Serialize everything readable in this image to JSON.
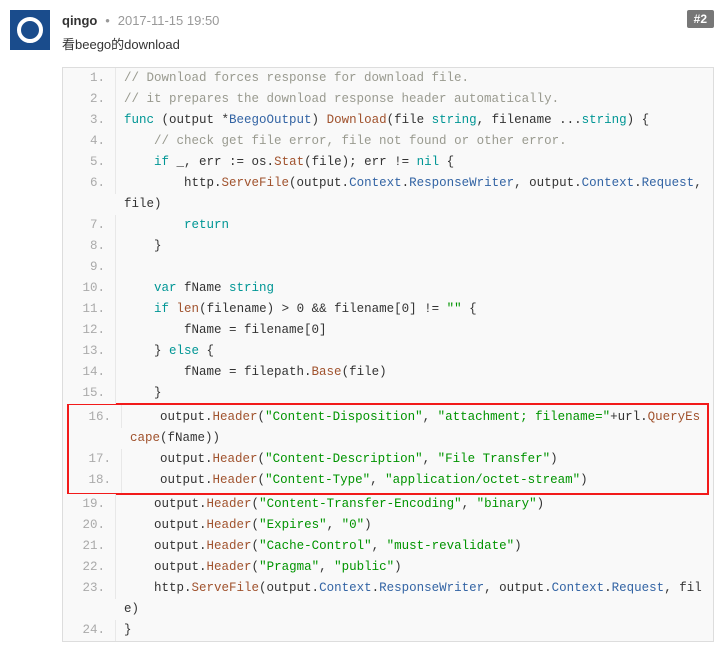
{
  "post": {
    "username": "qingo",
    "timestamp": "2017-11-15 19:50",
    "number": "#2",
    "body": "看beego的download"
  },
  "code": {
    "lines": [
      {
        "n": "1.",
        "tokens": [
          [
            "c-comment",
            "// Download forces response for download file."
          ]
        ],
        "hl": false
      },
      {
        "n": "2.",
        "tokens": [
          [
            "c-comment",
            "// it prepares the download response header automatically."
          ]
        ],
        "hl": false
      },
      {
        "n": "3.",
        "tokens": [
          [
            "c-keyword",
            "func"
          ],
          [
            "c-sym",
            " (output *"
          ],
          [
            "c-type",
            "BeegoOutput"
          ],
          [
            "c-sym",
            ") "
          ],
          [
            "c-func",
            "Download"
          ],
          [
            "c-sym",
            "(file "
          ],
          [
            "c-keyword",
            "string"
          ],
          [
            "c-sym",
            ", filename ..."
          ],
          [
            "c-keyword",
            "string"
          ],
          [
            "c-sym",
            ") {"
          ]
        ],
        "hl": false
      },
      {
        "n": "4.",
        "tokens": [
          [
            "c-sym",
            "    "
          ],
          [
            "c-comment",
            "// check get file error, file not found or other error."
          ]
        ],
        "hl": false
      },
      {
        "n": "5.",
        "tokens": [
          [
            "c-sym",
            "    "
          ],
          [
            "c-keyword",
            "if"
          ],
          [
            "c-sym",
            " _, err := os."
          ],
          [
            "c-func",
            "Stat"
          ],
          [
            "c-sym",
            "(file); err != "
          ],
          [
            "c-keyword",
            "nil"
          ],
          [
            "c-sym",
            " {"
          ]
        ],
        "hl": false
      },
      {
        "n": "6.",
        "tokens": [
          [
            "c-sym",
            "        http."
          ],
          [
            "c-func",
            "ServeFile"
          ],
          [
            "c-sym",
            "(output."
          ],
          [
            "c-pkg",
            "Context"
          ],
          [
            "c-sym",
            "."
          ],
          [
            "c-pkg",
            "ResponseWriter"
          ],
          [
            "c-sym",
            ", output."
          ],
          [
            "c-pkg",
            "Context"
          ],
          [
            "c-sym",
            "."
          ],
          [
            "c-pkg",
            "Request"
          ],
          [
            "c-sym",
            ", file)"
          ]
        ],
        "hl": false
      },
      {
        "n": "7.",
        "tokens": [
          [
            "c-sym",
            "        "
          ],
          [
            "c-keyword",
            "return"
          ]
        ],
        "hl": false
      },
      {
        "n": "8.",
        "tokens": [
          [
            "c-sym",
            "    }"
          ]
        ],
        "hl": false
      },
      {
        "n": "9.",
        "tokens": [
          [
            "c-sym",
            " "
          ]
        ],
        "hl": false
      },
      {
        "n": "10.",
        "tokens": [
          [
            "c-sym",
            "    "
          ],
          [
            "c-keyword",
            "var"
          ],
          [
            "c-sym",
            " fName "
          ],
          [
            "c-keyword",
            "string"
          ]
        ],
        "hl": false
      },
      {
        "n": "11.",
        "tokens": [
          [
            "c-sym",
            "    "
          ],
          [
            "c-keyword",
            "if"
          ],
          [
            "c-sym",
            " "
          ],
          [
            "c-func",
            "len"
          ],
          [
            "c-sym",
            "(filename) > 0 && filename[0] != "
          ],
          [
            "c-string",
            "\"\""
          ],
          [
            "c-sym",
            " {"
          ]
        ],
        "hl": false
      },
      {
        "n": "12.",
        "tokens": [
          [
            "c-sym",
            "        fName = filename[0]"
          ]
        ],
        "hl": false
      },
      {
        "n": "13.",
        "tokens": [
          [
            "c-sym",
            "    } "
          ],
          [
            "c-keyword",
            "else"
          ],
          [
            "c-sym",
            " {"
          ]
        ],
        "hl": false
      },
      {
        "n": "14.",
        "tokens": [
          [
            "c-sym",
            "        fName = filepath."
          ],
          [
            "c-func",
            "Base"
          ],
          [
            "c-sym",
            "(file)"
          ]
        ],
        "hl": false
      },
      {
        "n": "15.",
        "tokens": [
          [
            "c-sym",
            "    }"
          ]
        ],
        "hl": false
      },
      {
        "n": "16.",
        "tokens": [
          [
            "c-sym",
            "    output."
          ],
          [
            "c-func",
            "Header"
          ],
          [
            "c-sym",
            "("
          ],
          [
            "c-string",
            "\"Content-Disposition\""
          ],
          [
            "c-sym",
            ", "
          ],
          [
            "c-string",
            "\"attachment; filename=\""
          ],
          [
            "c-sym",
            "+url."
          ],
          [
            "c-func",
            "QueryEscape"
          ],
          [
            "c-sym",
            "(fName))"
          ]
        ],
        "hl": true
      },
      {
        "n": "17.",
        "tokens": [
          [
            "c-sym",
            "    output."
          ],
          [
            "c-func",
            "Header"
          ],
          [
            "c-sym",
            "("
          ],
          [
            "c-string",
            "\"Content-Description\""
          ],
          [
            "c-sym",
            ", "
          ],
          [
            "c-string",
            "\"File Transfer\""
          ],
          [
            "c-sym",
            ")"
          ]
        ],
        "hl": true
      },
      {
        "n": "18.",
        "tokens": [
          [
            "c-sym",
            "    output."
          ],
          [
            "c-func",
            "Header"
          ],
          [
            "c-sym",
            "("
          ],
          [
            "c-string",
            "\"Content-Type\""
          ],
          [
            "c-sym",
            ", "
          ],
          [
            "c-string",
            "\"application/octet-stream\""
          ],
          [
            "c-sym",
            ")"
          ]
        ],
        "hl": true
      },
      {
        "n": "19.",
        "tokens": [
          [
            "c-sym",
            "    output."
          ],
          [
            "c-func",
            "Header"
          ],
          [
            "c-sym",
            "("
          ],
          [
            "c-string",
            "\"Content-Transfer-Encoding\""
          ],
          [
            "c-sym",
            ", "
          ],
          [
            "c-string",
            "\"binary\""
          ],
          [
            "c-sym",
            ")"
          ]
        ],
        "hl": false
      },
      {
        "n": "20.",
        "tokens": [
          [
            "c-sym",
            "    output."
          ],
          [
            "c-func",
            "Header"
          ],
          [
            "c-sym",
            "("
          ],
          [
            "c-string",
            "\"Expires\""
          ],
          [
            "c-sym",
            ", "
          ],
          [
            "c-string",
            "\"0\""
          ],
          [
            "c-sym",
            ")"
          ]
        ],
        "hl": false
      },
      {
        "n": "21.",
        "tokens": [
          [
            "c-sym",
            "    output."
          ],
          [
            "c-func",
            "Header"
          ],
          [
            "c-sym",
            "("
          ],
          [
            "c-string",
            "\"Cache-Control\""
          ],
          [
            "c-sym",
            ", "
          ],
          [
            "c-string",
            "\"must-revalidate\""
          ],
          [
            "c-sym",
            ")"
          ]
        ],
        "hl": false
      },
      {
        "n": "22.",
        "tokens": [
          [
            "c-sym",
            "    output."
          ],
          [
            "c-func",
            "Header"
          ],
          [
            "c-sym",
            "("
          ],
          [
            "c-string",
            "\"Pragma\""
          ],
          [
            "c-sym",
            ", "
          ],
          [
            "c-string",
            "\"public\""
          ],
          [
            "c-sym",
            ")"
          ]
        ],
        "hl": false
      },
      {
        "n": "23.",
        "tokens": [
          [
            "c-sym",
            "    http."
          ],
          [
            "c-func",
            "ServeFile"
          ],
          [
            "c-sym",
            "(output."
          ],
          [
            "c-pkg",
            "Context"
          ],
          [
            "c-sym",
            "."
          ],
          [
            "c-pkg",
            "ResponseWriter"
          ],
          [
            "c-sym",
            ", output."
          ],
          [
            "c-pkg",
            "Context"
          ],
          [
            "c-sym",
            "."
          ],
          [
            "c-pkg",
            "Request"
          ],
          [
            "c-sym",
            ", file)"
          ]
        ],
        "hl": false
      },
      {
        "n": "24.",
        "tokens": [
          [
            "c-sym",
            "}"
          ]
        ],
        "hl": false
      }
    ]
  }
}
